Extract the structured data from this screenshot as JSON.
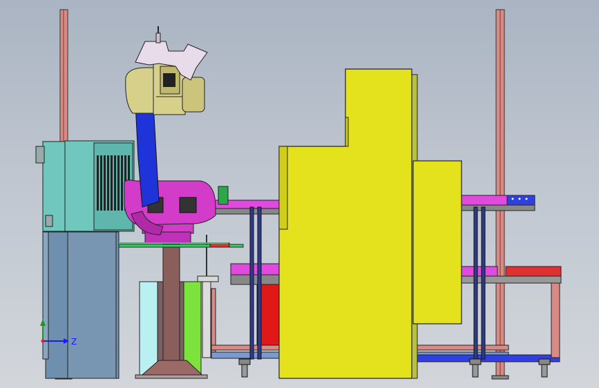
{
  "scene": {
    "view": "side",
    "background_top": "#aab4c2",
    "background_bottom": "#d2d6db"
  },
  "colors": {
    "robot_body": "#d7d08a",
    "robot_arm": "#1e34d8",
    "robot_base": "#d23cc8",
    "machine_yellow": "#e3e21c",
    "control_cabinet": "#6fc7be",
    "pedestal_blue": "#6e8fae",
    "conveyor_magenta": "#e04adf",
    "conveyor_blue": "#3040e0",
    "conveyor_red": "#e03030",
    "red_block": "#e01818",
    "post_salmon": "#d88a84",
    "cyan_panel": "#b9f0f2",
    "green_panel": "#7ee23c"
  },
  "triad": {
    "z_label": "Z"
  }
}
